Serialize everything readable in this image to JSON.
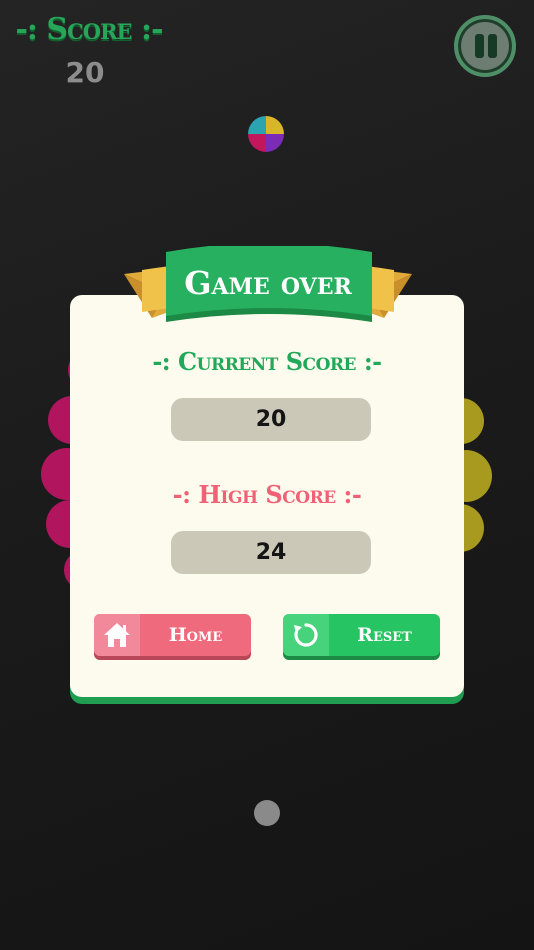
{
  "hud": {
    "score_title": "-: Score :-",
    "score_value": "20",
    "pause_icon": "pause-icon"
  },
  "colors": {
    "green": "#27a65a",
    "pink": "#ef6275",
    "ribbon_gold": "#f0c24a",
    "panel_bg": "#fcfbee",
    "score_box": "#cbc8b8",
    "ball_colors": [
      "#29a4b0",
      "#d8b62a",
      "#c2185b",
      "#7b2bb5"
    ]
  },
  "dialog": {
    "title": "Game over",
    "current_score_label": "-: Current Score :-",
    "current_score_value": "20",
    "high_score_label": "-: High Score :-",
    "high_score_value": "24",
    "home_button": "Home",
    "home_icon": "home-icon",
    "reset_button": "Reset",
    "reset_icon": "refresh-icon"
  }
}
